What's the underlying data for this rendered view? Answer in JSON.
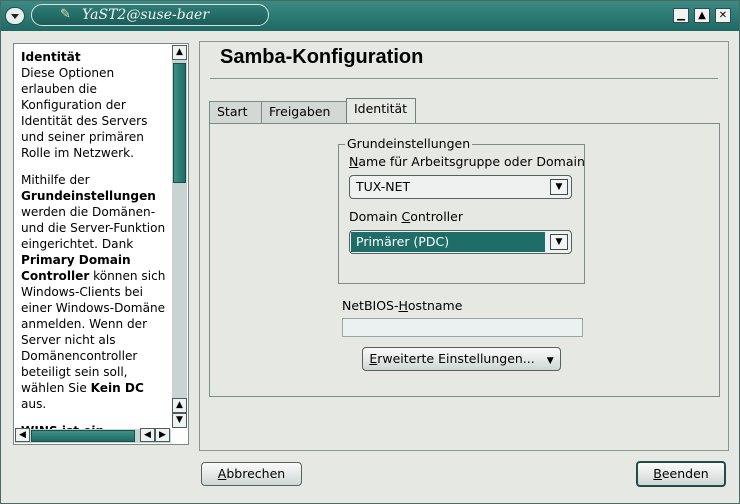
{
  "window": {
    "title": "YaST2@suse-baer",
    "controls": {
      "minimize": "▁",
      "maximize": "▲",
      "close": "✕"
    }
  },
  "help": {
    "heading": "Identität",
    "para1": "Diese Optionen erlauben die Konfiguration der Identität des Servers und seiner primären Rolle im Netzwerk.",
    "p2_a": "Mithilfe der ",
    "p2_b": "Grundeinstellungen",
    "p2_c": " werden die Domänen- und die Server-Funktion eingerichtet. Dank ",
    "p2_d": "Primary Domain Controller",
    "p2_e": " können sich Windows-Clients bei einer Windows-Domäne anmelden. Wenn der Server nicht als Domänencontroller beteiligt sein soll, wählen Sie ",
    "p2_f": "Kein DC",
    "p2_g": " aus.",
    "p3": "WINS ist ein"
  },
  "main": {
    "title": "Samba-Konfiguration",
    "tabs": [
      "Start",
      "Freigaben",
      "Identität"
    ],
    "active_tab": "Identität",
    "group_title": "Grundeinstellungen",
    "workgroup_label": {
      "pre": "",
      "key": "N",
      "post": "ame für Arbeitsgruppe oder Domain"
    },
    "workgroup_value": "TUX-NET",
    "dc_label": {
      "pre": "Domain ",
      "key": "C",
      "post": "ontroller"
    },
    "dc_value": "Primärer (PDC)",
    "netbios_label": {
      "pre": "NetBIOS-",
      "key": "H",
      "post": "ostname"
    },
    "netbios_value": "",
    "advanced_button": {
      "pre": "",
      "key": "E",
      "post": "rweiterte Einstellungen..."
    }
  },
  "footer": {
    "cancel": {
      "pre": "",
      "key": "A",
      "post": "bbrechen"
    },
    "finish": {
      "pre": "",
      "key": "B",
      "post": "eenden"
    }
  },
  "colors": {
    "accent": "#1f6d67",
    "titlebar": "#2f7c76"
  }
}
